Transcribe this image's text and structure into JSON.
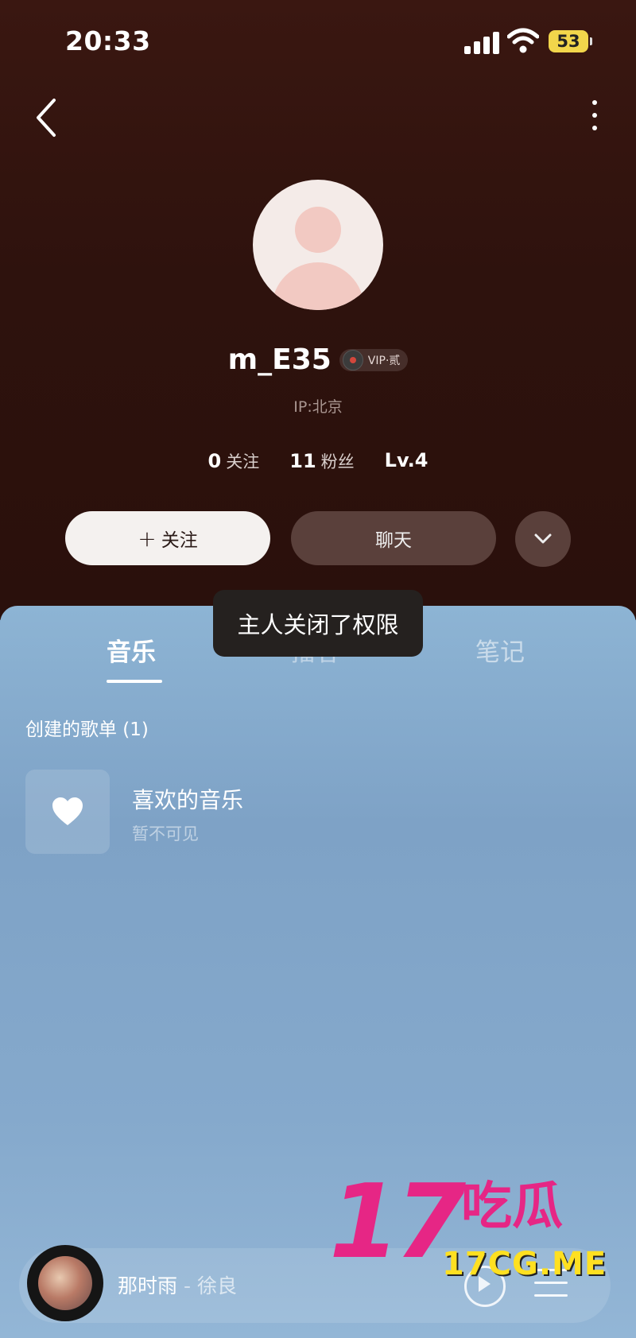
{
  "status_bar": {
    "time": "20:33",
    "battery": "53"
  },
  "profile": {
    "username": "m_E35",
    "vip_badge": "VIP·贰",
    "ip_location": "IP:北京",
    "following_count": "0",
    "following_label": "关注",
    "followers_count": "11",
    "followers_label": "粉丝",
    "level": "Lv.4"
  },
  "actions": {
    "follow_plus": "+",
    "follow_label": "关注",
    "chat_label": "聊天"
  },
  "tabs": [
    {
      "label": "音乐",
      "active": true
    },
    {
      "label": "播客",
      "active": false
    },
    {
      "label": "笔记",
      "active": false
    }
  ],
  "toast": "主人关闭了权限",
  "playlists": {
    "section_title": "创建的歌单 (1)",
    "items": [
      {
        "title": "喜欢的音乐",
        "subtitle": "暂不可见",
        "icon": "heart-icon"
      }
    ]
  },
  "now_playing": {
    "song": "那时雨",
    "separator": "-",
    "artist": "徐良"
  },
  "watermark": {
    "number": "17",
    "chinese": "吃瓜",
    "url": "17CG.ME"
  },
  "colors": {
    "accent_pink": "#e62685",
    "watermark_yellow": "#ffe021",
    "header_bg": "#2e120d",
    "panel_blue": "#7ea2c6"
  }
}
